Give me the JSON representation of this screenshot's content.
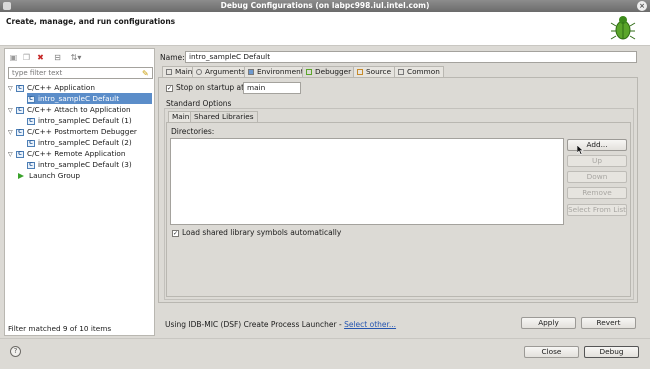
{
  "window": {
    "title": "Debug Configurations  (on labpc998.iul.intel.com)",
    "close_glyph": "×"
  },
  "header": {
    "title": "Create, manage, and run configurations",
    "icon": "bug-icon"
  },
  "left_toolbar": {
    "icons": [
      "new-config-icon",
      "duplicate-icon",
      "delete-icon",
      "collapse-all-icon",
      "filter-icon"
    ],
    "glyphs": [
      "▣",
      "❐",
      "✖",
      "⊟",
      "⇅▾"
    ]
  },
  "filter": {
    "placeholder": "type filter text",
    "clear_glyph": "✎"
  },
  "tree": [
    {
      "label": "C/C++ Application",
      "level": 0,
      "expanded": true,
      "icon": "c-app-icon",
      "glyph": "C"
    },
    {
      "label": "intro_sampleC Default",
      "level": 1,
      "selected": true,
      "icon": "c-config-icon",
      "glyph": "C"
    },
    {
      "label": "C/C++ Attach to Application",
      "level": 0,
      "expanded": true,
      "icon": "c-attach-icon",
      "glyph": "C"
    },
    {
      "label": "intro_sampleC Default (1)",
      "level": 1,
      "icon": "c-config-icon",
      "glyph": "C"
    },
    {
      "label": "C/C++ Postmortem Debugger",
      "level": 0,
      "expanded": true,
      "icon": "c-postmortem-icon",
      "glyph": "C"
    },
    {
      "label": "intro_sampleC Default (2)",
      "level": 1,
      "icon": "c-config-icon",
      "glyph": "C"
    },
    {
      "label": "C/C++ Remote Application",
      "level": 0,
      "expanded": true,
      "icon": "c-remote-icon",
      "glyph": "C"
    },
    {
      "label": "intro_sampleC Default (3)",
      "level": 1,
      "icon": "c-config-icon",
      "glyph": "C"
    },
    {
      "label": "Launch Group",
      "level": 0,
      "expanded": false,
      "icon": "launch-group-icon",
      "glyph": ""
    }
  ],
  "filter_status": "Filter matched 9 of 10 items",
  "config": {
    "name_label": "Name:",
    "name_value": "intro_sampleC Default"
  },
  "tabs": [
    {
      "label": "Main",
      "icon": "main-tab-icon"
    },
    {
      "label": "Arguments",
      "icon": "arguments-tab-icon"
    },
    {
      "label": "Environment",
      "icon": "environment-tab-icon"
    },
    {
      "label": "Debugger",
      "icon": "debugger-tab-icon",
      "active": true
    },
    {
      "label": "Source",
      "icon": "source-tab-icon"
    },
    {
      "label": "Common",
      "icon": "common-tab-icon"
    }
  ],
  "debugger": {
    "stop_on_startup_label": "Stop on startup at:",
    "stop_on_startup_checked": true,
    "stop_on_startup_value": "main",
    "standard_options_label": "Standard Options",
    "subtabs": [
      {
        "label": "Main"
      },
      {
        "label": "Shared Libraries",
        "active": true
      }
    ],
    "directories_label": "Directories:",
    "buttons": [
      {
        "label": "Add...",
        "enabled": true
      },
      {
        "label": "Up",
        "enabled": false
      },
      {
        "label": "Down",
        "enabled": false
      },
      {
        "label": "Remove",
        "enabled": false
      },
      {
        "label": "Select From List",
        "enabled": false
      }
    ],
    "load_shared_label": "Load shared library symbols automatically",
    "load_shared_checked": true
  },
  "launcher": {
    "text": "Using IDB-MIC (DSF) Create Process Launcher - ",
    "link": "Select other..."
  },
  "actions": {
    "apply": "Apply",
    "revert": "Revert",
    "close": "Close",
    "debug": "Debug"
  },
  "help_glyph": "?",
  "check_glyph": "✓"
}
